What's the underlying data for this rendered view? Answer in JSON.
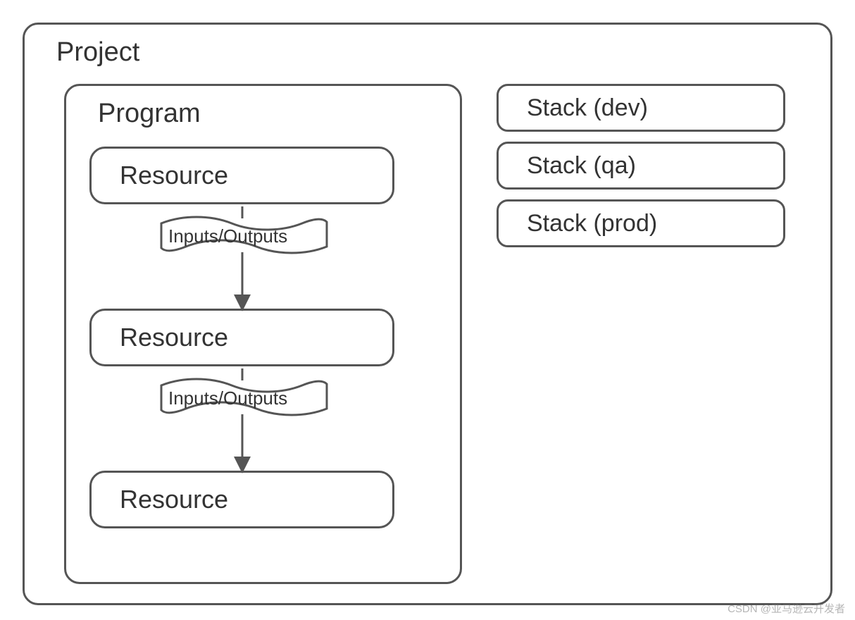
{
  "project": {
    "label": "Project",
    "program": {
      "label": "Program",
      "resources": [
        "Resource",
        "Resource",
        "Resource"
      ],
      "flow_labels": [
        "Inputs/Outputs",
        "Inputs/Outputs"
      ]
    },
    "stacks": [
      "Stack (dev)",
      "Stack (qa)",
      "Stack (prod)"
    ]
  },
  "watermark": "CSDN @亚马逊云开发者"
}
